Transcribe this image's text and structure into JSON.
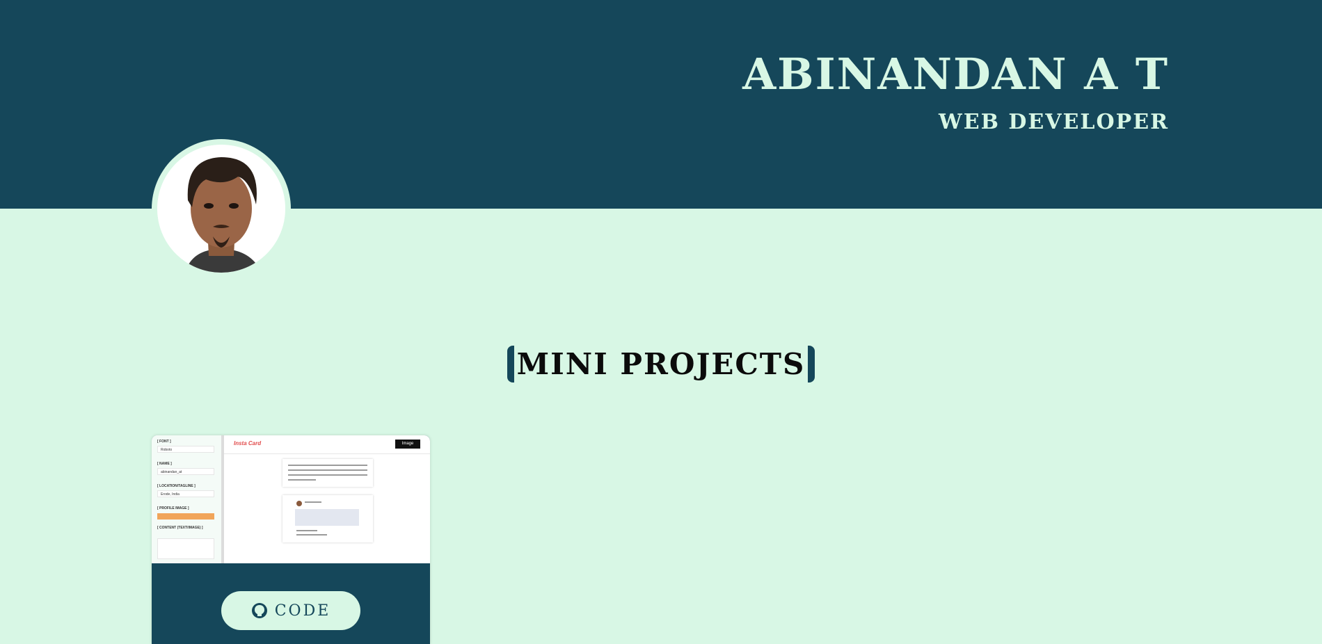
{
  "header": {
    "name": "ABINANDAN A T",
    "role": "WEB DEVELOPER"
  },
  "avatar": {
    "alt": "profile photo"
  },
  "projects_section": {
    "title": "MINI PROJECTS"
  },
  "projects": [
    {
      "preview": {
        "app_name": "Insta Card",
        "download_button": "Image",
        "sidebar": {
          "font_label": "[ FONT ]",
          "font_value": "Roboto",
          "name_label": "[ NAME ]",
          "name_value": "abinandan_at",
          "location_label": "[ LOCATION/TAGLINE ]",
          "location_value": "Erode, India",
          "profile_label": "[ PROFILE IMAGE ]",
          "content_label": "[ CONTENT (TEXT/IMAGE) ]"
        }
      },
      "code_button": {
        "label": "CODE",
        "icon": "github-icon"
      }
    }
  ],
  "colors": {
    "primary": "#15475a",
    "background": "#d8f7e5"
  }
}
